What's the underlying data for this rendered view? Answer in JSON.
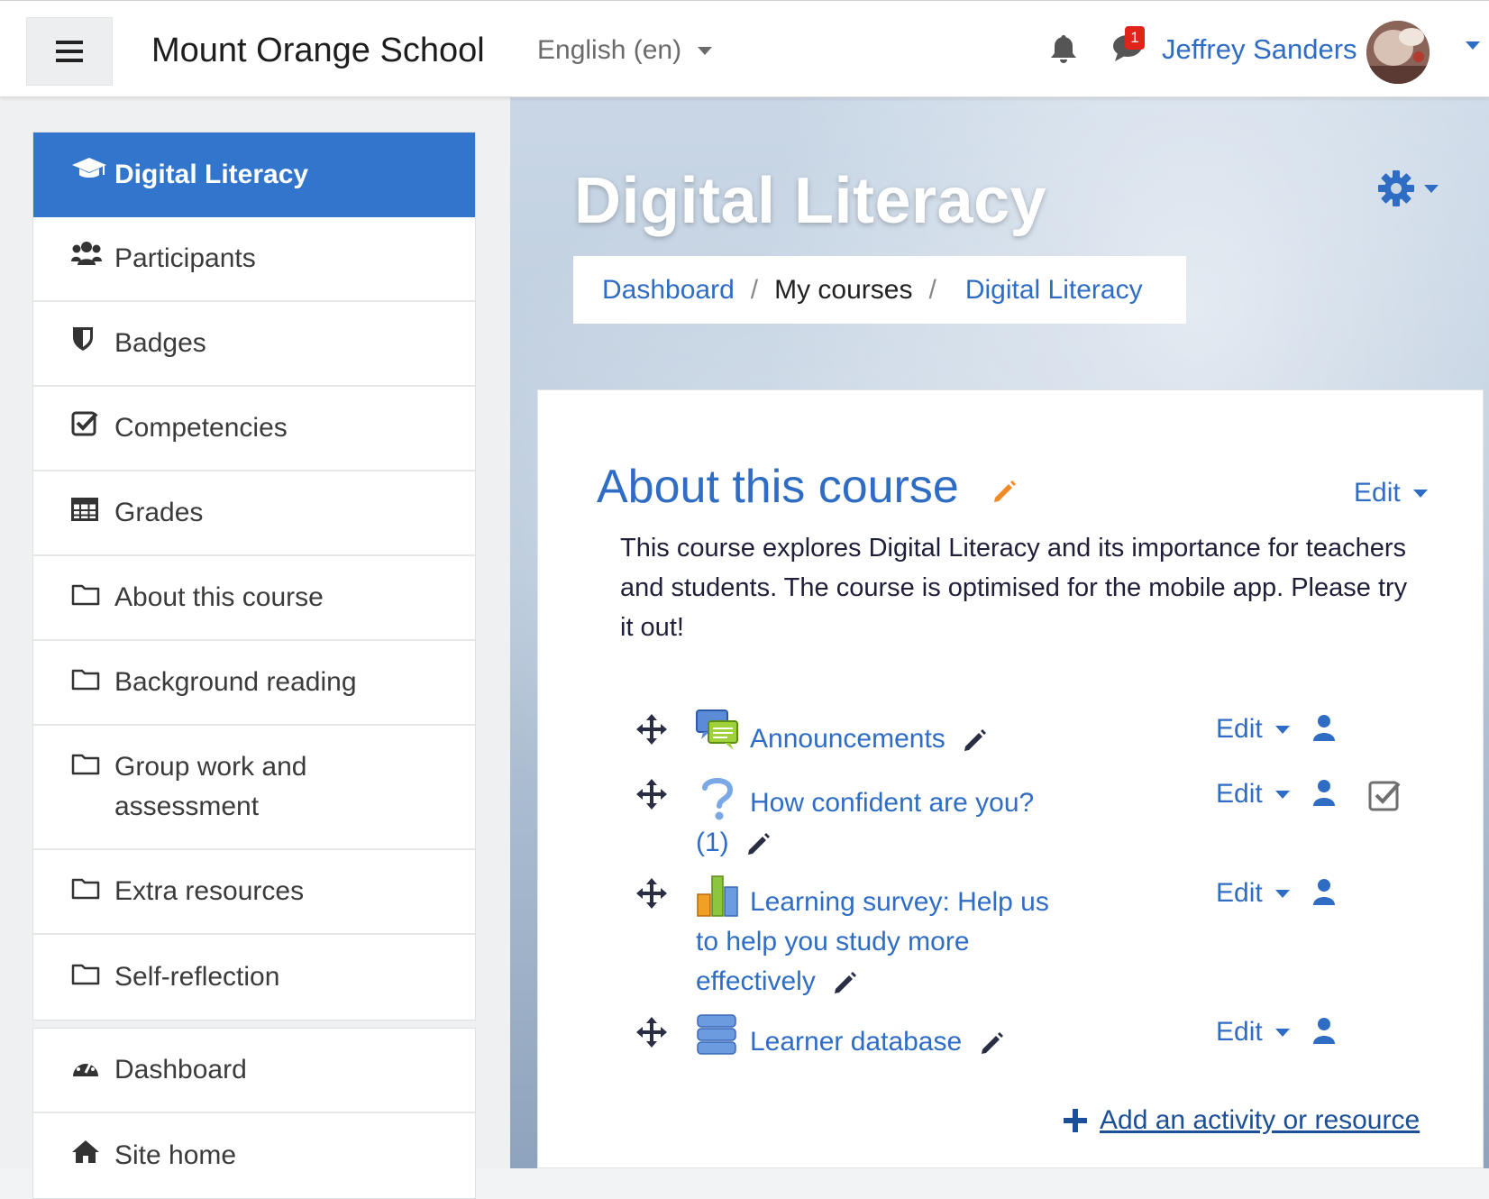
{
  "navbar": {
    "site_name": "Mount Orange School",
    "language": "English (en)",
    "message_count": "1",
    "user_name": "Jeffrey Sanders"
  },
  "drawer": {
    "items": [
      {
        "label": "Digital Literacy",
        "icon": "graduation-cap-icon",
        "active": true
      },
      {
        "label": "Participants",
        "icon": "users-icon"
      },
      {
        "label": "Badges",
        "icon": "shield-icon"
      },
      {
        "label": "Competencies",
        "icon": "check-square-icon"
      },
      {
        "label": "Grades",
        "icon": "table-icon"
      },
      {
        "label": "About this course",
        "icon": "folder-icon"
      },
      {
        "label": "Background reading",
        "icon": "folder-icon"
      },
      {
        "label": "Group work and assessment",
        "icon": "folder-icon"
      },
      {
        "label": "Extra resources",
        "icon": "folder-icon"
      },
      {
        "label": "Self-reflection",
        "icon": "folder-icon"
      }
    ],
    "items2": [
      {
        "label": "Dashboard",
        "icon": "dashboard-icon"
      },
      {
        "label": "Site home",
        "icon": "home-icon"
      }
    ]
  },
  "header": {
    "course_title": "Digital Literacy",
    "breadcrumb": [
      "Dashboard",
      "My courses",
      "Digital Literacy"
    ]
  },
  "section": {
    "title": "About this course",
    "edit_label": "Edit",
    "summary": "This course explores Digital Literacy and its importance for teachers and students. The course is optimised for the mobile app. Please try it out!",
    "activities": [
      {
        "name": "Announcements",
        "icon": "forum-icon",
        "edit": "Edit"
      },
      {
        "name": "How confident are you? (1)",
        "icon": "question-icon",
        "edit": "Edit"
      },
      {
        "name": "Learning survey: Help us to help you study more effectively",
        "icon": "survey-chart-icon",
        "edit": "Edit"
      },
      {
        "name": "Learner database",
        "icon": "database-icon",
        "edit": "Edit"
      }
    ],
    "add_activity": "Add an activity or resource"
  },
  "colors": {
    "accent": "#3175cc",
    "link": "#2f6dc4",
    "badge": "#e0241a"
  }
}
